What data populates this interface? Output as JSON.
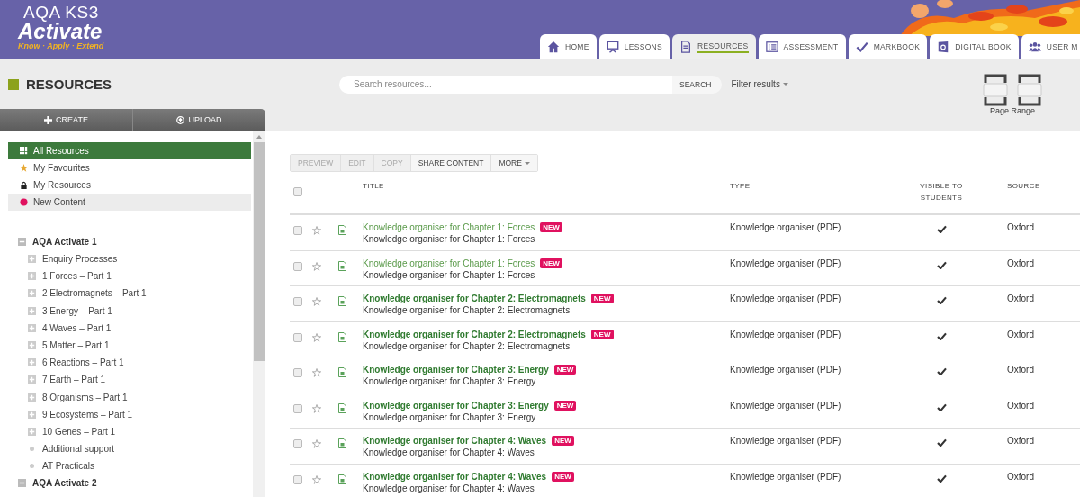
{
  "brand": {
    "line1": "AQA KS3",
    "line2": "Activate",
    "tagline": "Know · Apply · Extend"
  },
  "nav_tabs": [
    {
      "label": "HOME",
      "kind": "home",
      "selected": false
    },
    {
      "label": "LESSONS",
      "kind": "lessons",
      "selected": false
    },
    {
      "label": "RESOURCES",
      "kind": "resources",
      "selected": true
    },
    {
      "label": "ASSESSMENT",
      "kind": "assessment",
      "selected": false
    },
    {
      "label": "MARKBOOK",
      "kind": "markbook",
      "selected": false
    },
    {
      "label": "DIGITAL BOOK",
      "kind": "book",
      "selected": false
    },
    {
      "label": "USER M",
      "kind": "users",
      "selected": false
    }
  ],
  "page_title": "RESOURCES",
  "search": {
    "placeholder": "Search resources...",
    "button": "SEARCH",
    "filter": "Filter results"
  },
  "page_range": {
    "label": "Page Range"
  },
  "sidebar": {
    "buttons": [
      {
        "label": "CREATE",
        "kind": "plus"
      },
      {
        "label": "UPLOAD",
        "kind": "upload"
      }
    ],
    "filters": [
      {
        "label": "All Resources",
        "kind": "grid",
        "selected": true,
        "hovered": false
      },
      {
        "label": "My Favourites",
        "kind": "star",
        "selected": false,
        "hovered": false
      },
      {
        "label": "My Resources",
        "kind": "lock",
        "selected": false,
        "hovered": false
      },
      {
        "label": "New Content",
        "kind": "dot",
        "selected": false,
        "hovered": true
      }
    ],
    "tree": [
      {
        "label": "AQA Activate 1",
        "expanded": true,
        "children": [
          {
            "label": "Enquiry Processes",
            "kind": "folder"
          },
          {
            "label": "1 Forces – Part 1",
            "kind": "folder"
          },
          {
            "label": "2 Electromagnets – Part 1",
            "kind": "folder"
          },
          {
            "label": "3 Energy – Part 1",
            "kind": "folder"
          },
          {
            "label": "4 Waves – Part 1",
            "kind": "folder"
          },
          {
            "label": "5 Matter – Part 1",
            "kind": "folder"
          },
          {
            "label": "6 Reactions – Part 1",
            "kind": "folder"
          },
          {
            "label": "7 Earth – Part 1",
            "kind": "folder"
          },
          {
            "label": "8 Organisms – Part 1",
            "kind": "folder"
          },
          {
            "label": "9 Ecosystems – Part 1",
            "kind": "folder"
          },
          {
            "label": "10 Genes – Part 1",
            "kind": "folder"
          },
          {
            "label": "Additional support",
            "kind": "leaf"
          },
          {
            "label": "AT Practicals",
            "kind": "leaf"
          }
        ]
      },
      {
        "label": "AQA Activate 2",
        "expanded": true
      }
    ]
  },
  "actions": [
    {
      "label": "PREVIEW",
      "disabled": true
    },
    {
      "label": "EDIT",
      "disabled": true
    },
    {
      "label": "COPY",
      "disabled": true
    },
    {
      "label": "SHARE CONTENT",
      "disabled": false
    },
    {
      "label": "MORE",
      "disabled": false
    }
  ],
  "table": {
    "select_all_checked": false,
    "columns": [
      "TITLE",
      "TYPE",
      "VISIBLE TO STUDENTS",
      "SOURCE"
    ],
    "rows": [
      {
        "title": "Knowledge organiser for Chapter 1: Forces",
        "badge": "NEW",
        "subtitle": "Knowledge organiser for Chapter 1: Forces",
        "type": "Knowledge organiser (PDF)",
        "visible": true,
        "source": "Oxford",
        "visited": true,
        "checked": false,
        "favourite": false
      },
      {
        "title": "Knowledge organiser for Chapter 1: Forces",
        "badge": "NEW",
        "subtitle": "Knowledge organiser for Chapter 1: Forces",
        "type": "Knowledge organiser (PDF)",
        "visible": true,
        "source": "Oxford",
        "visited": true,
        "checked": false,
        "favourite": false
      },
      {
        "title": "Knowledge organiser for Chapter 2: Electromagnets",
        "badge": "NEW",
        "subtitle": "Knowledge organiser for Chapter 2: Electromagnets",
        "type": "Knowledge organiser (PDF)",
        "visible": true,
        "source": "Oxford",
        "visited": false,
        "checked": false,
        "favourite": false
      },
      {
        "title": "Knowledge organiser for Chapter 2: Electromagnets",
        "badge": "NEW",
        "subtitle": "Knowledge organiser for Chapter 2: Electromagnets",
        "type": "Knowledge organiser (PDF)",
        "visible": true,
        "source": "Oxford",
        "visited": false,
        "checked": false,
        "favourite": false
      },
      {
        "title": "Knowledge organiser for Chapter 3: Energy",
        "badge": "NEW",
        "subtitle": "Knowledge organiser for Chapter 3: Energy",
        "type": "Knowledge organiser (PDF)",
        "visible": true,
        "source": "Oxford",
        "visited": false,
        "checked": false,
        "favourite": false
      },
      {
        "title": "Knowledge organiser for Chapter 3: Energy",
        "badge": "NEW",
        "subtitle": "Knowledge organiser for Chapter 3: Energy",
        "type": "Knowledge organiser (PDF)",
        "visible": true,
        "source": "Oxford",
        "visited": false,
        "checked": false,
        "favourite": false
      },
      {
        "title": "Knowledge organiser for Chapter 4: Waves",
        "badge": "NEW",
        "subtitle": "Knowledge organiser for Chapter 4: Waves",
        "type": "Knowledge organiser (PDF)",
        "visible": true,
        "source": "Oxford",
        "visited": false,
        "checked": false,
        "favourite": false
      },
      {
        "title": "Knowledge organiser for Chapter 4: Waves",
        "badge": "NEW",
        "subtitle": "Knowledge organiser for Chapter 4: Waves",
        "type": "Knowledge organiser (PDF)",
        "visible": true,
        "source": "Oxford",
        "visited": false,
        "checked": false,
        "favourite": false
      }
    ]
  }
}
